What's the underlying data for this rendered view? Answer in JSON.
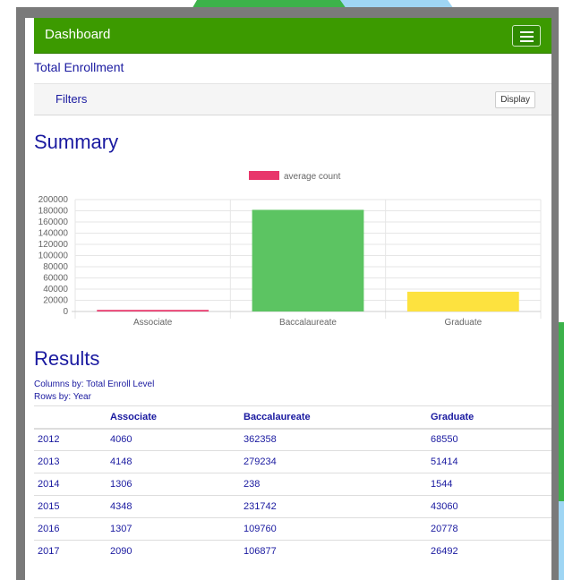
{
  "navbar": {
    "brand": "Dashboard"
  },
  "page": {
    "subtitle": "Total Enrollment"
  },
  "filters": {
    "label": "Filters",
    "display_label": "Display"
  },
  "summary": {
    "title": "Summary"
  },
  "chart_data": {
    "type": "bar",
    "categories": [
      "Associate",
      "Baccalaureate",
      "Graduate"
    ],
    "series": [
      {
        "name": "average count",
        "values": [
          2793,
          181702,
          35306
        ]
      }
    ],
    "bar_colors": [
      "#e8376b",
      "#5cc462",
      "#fde23f"
    ],
    "legend_color": "#e8376b",
    "yticks": [
      0,
      20000,
      40000,
      60000,
      80000,
      100000,
      120000,
      140000,
      160000,
      180000,
      200000
    ],
    "ylim": [
      0,
      200000
    ],
    "grid": true,
    "legend_position": "top"
  },
  "results": {
    "title": "Results",
    "columns_by": "Columns by: Total Enroll Level",
    "rows_by": "Rows by: Year",
    "headers": [
      "",
      "Associate",
      "Baccalaureate",
      "Graduate"
    ],
    "rows": [
      [
        "2012",
        "4060",
        "362358",
        "68550"
      ],
      [
        "2013",
        "4148",
        "279234",
        "51414"
      ],
      [
        "2014",
        "1306",
        "238",
        "1544"
      ],
      [
        "2015",
        "4348",
        "231742",
        "43060"
      ],
      [
        "2016",
        "1307",
        "109760",
        "20778"
      ],
      [
        "2017",
        "2090",
        "106877",
        "26492"
      ]
    ]
  },
  "colors": {
    "navbar": "#3c9a00",
    "heading": "#1a1aa0"
  }
}
